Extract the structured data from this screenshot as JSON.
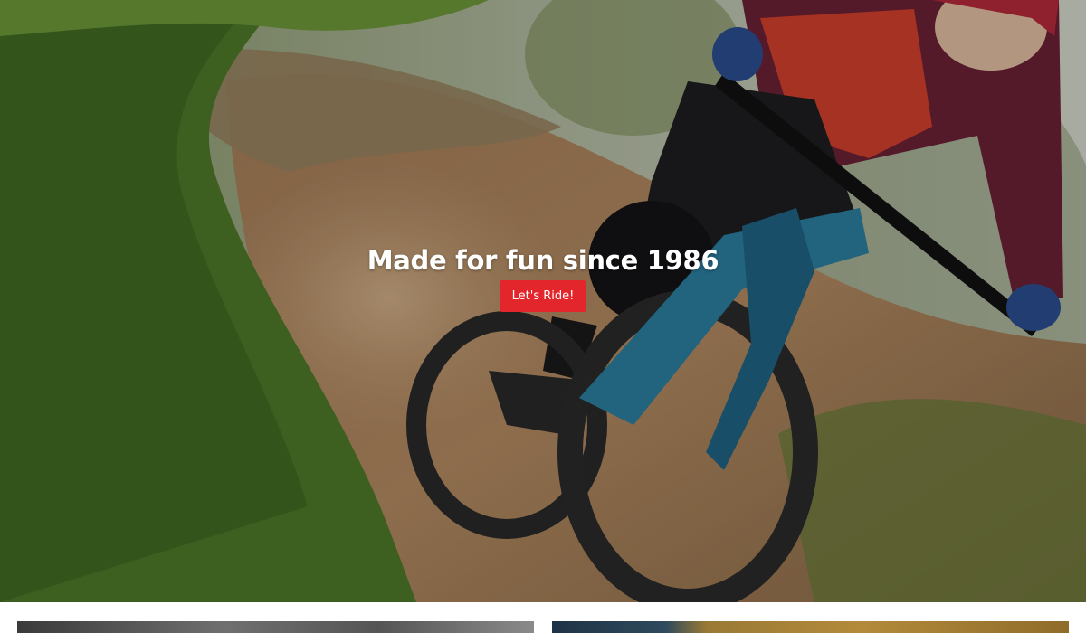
{
  "hero": {
    "title": "Made for fun since 1986",
    "cta_label": "Let's Ride!",
    "cta_color": "#e3262b",
    "image_description_icon": "mountain-bike-photo"
  },
  "cards": [
    {
      "name": "feature-card-left"
    },
    {
      "name": "feature-card-right"
    }
  ]
}
